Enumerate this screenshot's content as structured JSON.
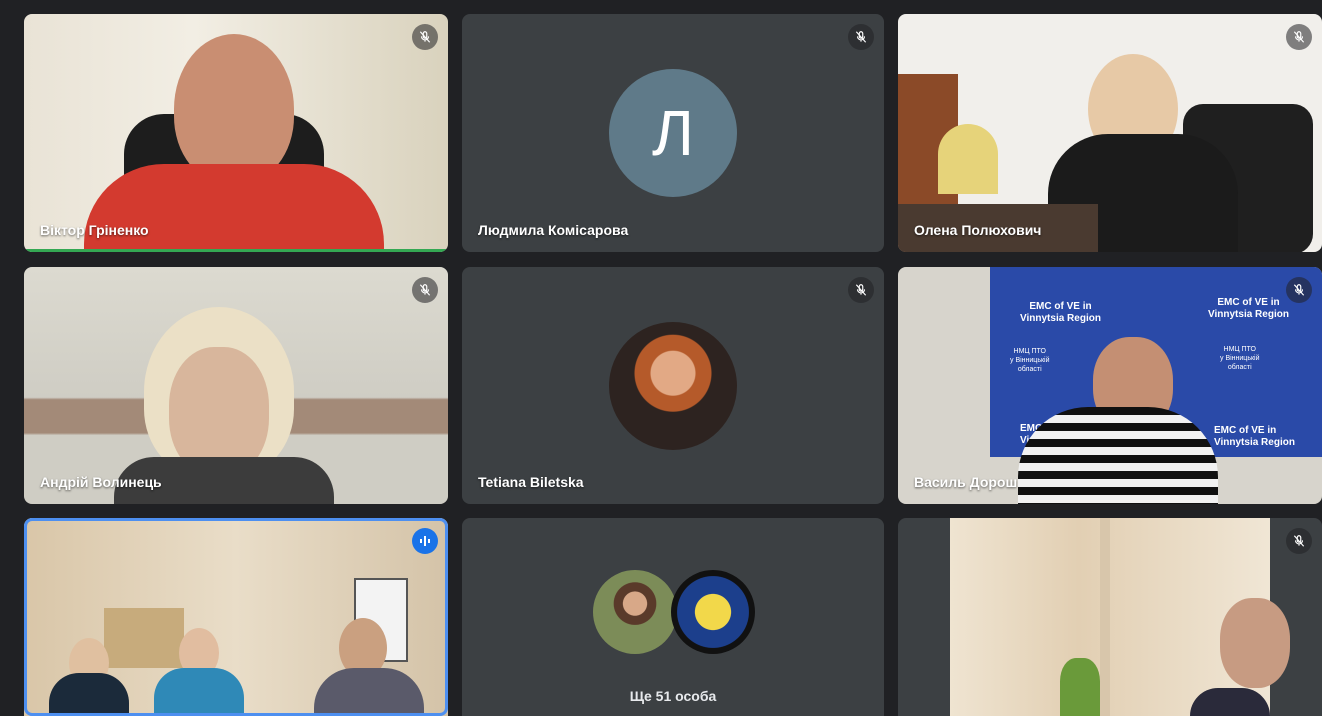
{
  "participants": [
    {
      "name": "Віктор Гріненко",
      "muted": true
    },
    {
      "name": "Людмила Комісарова",
      "initial": "Л",
      "muted": true
    },
    {
      "name": "Олена Полюхович",
      "muted": true
    },
    {
      "name": "Андрій Волинець",
      "muted": true
    },
    {
      "name": "Tetiana Biletska",
      "muted": true
    },
    {
      "name": "Василь Дорош",
      "muted": true
    },
    {
      "name": "",
      "speaking": true
    },
    {
      "name": "",
      "muted": false
    },
    {
      "name": "",
      "muted": true
    }
  ],
  "more": {
    "label": "Ще 51 особа"
  },
  "banner": {
    "text1": "EMC of VE in",
    "text2": "Vinnytsia Region",
    "text3": "НМЦ ПТО",
    "text4": "у Вінницькій",
    "text5": "області"
  },
  "colors": {
    "background": "#202124",
    "tile": "#3c4043",
    "accent": "#1a73e8",
    "speaking": "#34a853",
    "avatar": "#5f7a89"
  }
}
